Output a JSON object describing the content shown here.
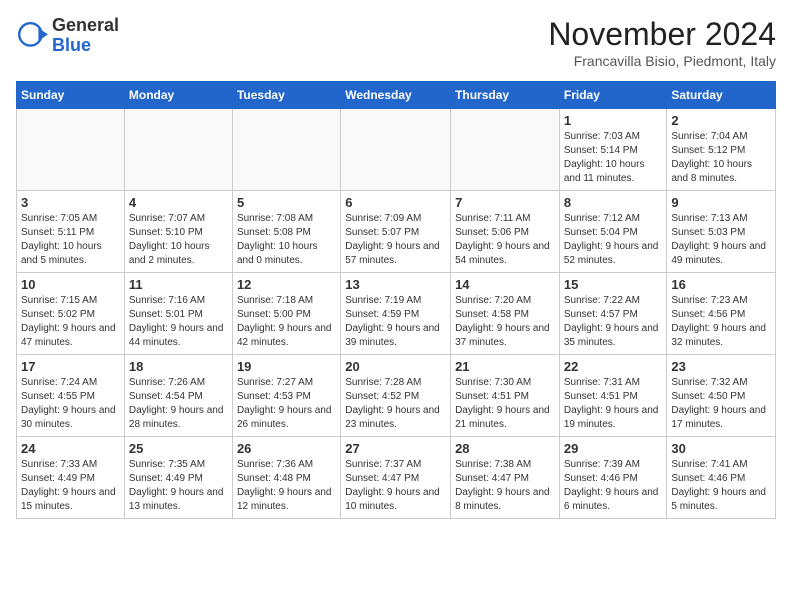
{
  "logo": {
    "general": "General",
    "blue": "Blue"
  },
  "title": "November 2024",
  "location": "Francavilla Bisio, Piedmont, Italy",
  "days_of_week": [
    "Sunday",
    "Monday",
    "Tuesday",
    "Wednesday",
    "Thursday",
    "Friday",
    "Saturday"
  ],
  "weeks": [
    [
      {
        "day": "",
        "info": ""
      },
      {
        "day": "",
        "info": ""
      },
      {
        "day": "",
        "info": ""
      },
      {
        "day": "",
        "info": ""
      },
      {
        "day": "",
        "info": ""
      },
      {
        "day": "1",
        "info": "Sunrise: 7:03 AM\nSunset: 5:14 PM\nDaylight: 10 hours and 11 minutes."
      },
      {
        "day": "2",
        "info": "Sunrise: 7:04 AM\nSunset: 5:12 PM\nDaylight: 10 hours and 8 minutes."
      }
    ],
    [
      {
        "day": "3",
        "info": "Sunrise: 7:05 AM\nSunset: 5:11 PM\nDaylight: 10 hours and 5 minutes."
      },
      {
        "day": "4",
        "info": "Sunrise: 7:07 AM\nSunset: 5:10 PM\nDaylight: 10 hours and 2 minutes."
      },
      {
        "day": "5",
        "info": "Sunrise: 7:08 AM\nSunset: 5:08 PM\nDaylight: 10 hours and 0 minutes."
      },
      {
        "day": "6",
        "info": "Sunrise: 7:09 AM\nSunset: 5:07 PM\nDaylight: 9 hours and 57 minutes."
      },
      {
        "day": "7",
        "info": "Sunrise: 7:11 AM\nSunset: 5:06 PM\nDaylight: 9 hours and 54 minutes."
      },
      {
        "day": "8",
        "info": "Sunrise: 7:12 AM\nSunset: 5:04 PM\nDaylight: 9 hours and 52 minutes."
      },
      {
        "day": "9",
        "info": "Sunrise: 7:13 AM\nSunset: 5:03 PM\nDaylight: 9 hours and 49 minutes."
      }
    ],
    [
      {
        "day": "10",
        "info": "Sunrise: 7:15 AM\nSunset: 5:02 PM\nDaylight: 9 hours and 47 minutes."
      },
      {
        "day": "11",
        "info": "Sunrise: 7:16 AM\nSunset: 5:01 PM\nDaylight: 9 hours and 44 minutes."
      },
      {
        "day": "12",
        "info": "Sunrise: 7:18 AM\nSunset: 5:00 PM\nDaylight: 9 hours and 42 minutes."
      },
      {
        "day": "13",
        "info": "Sunrise: 7:19 AM\nSunset: 4:59 PM\nDaylight: 9 hours and 39 minutes."
      },
      {
        "day": "14",
        "info": "Sunrise: 7:20 AM\nSunset: 4:58 PM\nDaylight: 9 hours and 37 minutes."
      },
      {
        "day": "15",
        "info": "Sunrise: 7:22 AM\nSunset: 4:57 PM\nDaylight: 9 hours and 35 minutes."
      },
      {
        "day": "16",
        "info": "Sunrise: 7:23 AM\nSunset: 4:56 PM\nDaylight: 9 hours and 32 minutes."
      }
    ],
    [
      {
        "day": "17",
        "info": "Sunrise: 7:24 AM\nSunset: 4:55 PM\nDaylight: 9 hours and 30 minutes."
      },
      {
        "day": "18",
        "info": "Sunrise: 7:26 AM\nSunset: 4:54 PM\nDaylight: 9 hours and 28 minutes."
      },
      {
        "day": "19",
        "info": "Sunrise: 7:27 AM\nSunset: 4:53 PM\nDaylight: 9 hours and 26 minutes."
      },
      {
        "day": "20",
        "info": "Sunrise: 7:28 AM\nSunset: 4:52 PM\nDaylight: 9 hours and 23 minutes."
      },
      {
        "day": "21",
        "info": "Sunrise: 7:30 AM\nSunset: 4:51 PM\nDaylight: 9 hours and 21 minutes."
      },
      {
        "day": "22",
        "info": "Sunrise: 7:31 AM\nSunset: 4:51 PM\nDaylight: 9 hours and 19 minutes."
      },
      {
        "day": "23",
        "info": "Sunrise: 7:32 AM\nSunset: 4:50 PM\nDaylight: 9 hours and 17 minutes."
      }
    ],
    [
      {
        "day": "24",
        "info": "Sunrise: 7:33 AM\nSunset: 4:49 PM\nDaylight: 9 hours and 15 minutes."
      },
      {
        "day": "25",
        "info": "Sunrise: 7:35 AM\nSunset: 4:49 PM\nDaylight: 9 hours and 13 minutes."
      },
      {
        "day": "26",
        "info": "Sunrise: 7:36 AM\nSunset: 4:48 PM\nDaylight: 9 hours and 12 minutes."
      },
      {
        "day": "27",
        "info": "Sunrise: 7:37 AM\nSunset: 4:47 PM\nDaylight: 9 hours and 10 minutes."
      },
      {
        "day": "28",
        "info": "Sunrise: 7:38 AM\nSunset: 4:47 PM\nDaylight: 9 hours and 8 minutes."
      },
      {
        "day": "29",
        "info": "Sunrise: 7:39 AM\nSunset: 4:46 PM\nDaylight: 9 hours and 6 minutes."
      },
      {
        "day": "30",
        "info": "Sunrise: 7:41 AM\nSunset: 4:46 PM\nDaylight: 9 hours and 5 minutes."
      }
    ]
  ]
}
